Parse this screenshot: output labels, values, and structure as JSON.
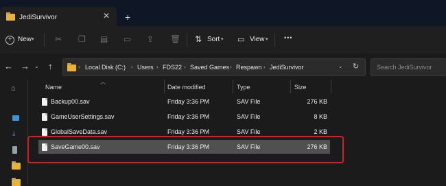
{
  "window": {
    "tab_title": "JediSurvivor"
  },
  "toolbar": {
    "new_label": "New",
    "sort_label": "Sort",
    "view_label": "View",
    "more_label": "•••"
  },
  "address": {
    "crumbs": [
      "Local Disk (C:)",
      "Users",
      "FDS22",
      "Saved Games",
      "Respawn",
      "JediSurvivor"
    ],
    "search_placeholder": "Search JediSurvivor"
  },
  "columns": {
    "name": "Name",
    "date": "Date modified",
    "type": "Type",
    "size": "Size"
  },
  "files": [
    {
      "name": "Backup00.sav",
      "date": "Friday 3:36 PM",
      "type": "SAV File",
      "size": "276 KB"
    },
    {
      "name": "GameUserSettings.sav",
      "date": "Friday 3:36 PM",
      "type": "SAV File",
      "size": "8 KB"
    },
    {
      "name": "GlobalSaveData.sav",
      "date": "Friday 3:36 PM",
      "type": "SAV File",
      "size": "2 KB"
    },
    {
      "name": "SaveGame00.sav",
      "date": "Friday 3:36 PM",
      "type": "SAV File",
      "size": "276 KB"
    }
  ],
  "colors": {
    "highlight": "#d61f1f",
    "folder": "#e8b23b",
    "selected_row": "#505050"
  },
  "icons": [
    "folder-icon",
    "close-icon",
    "plus-icon",
    "cut-icon",
    "copy-icon",
    "paste-icon",
    "rename-icon",
    "share-icon",
    "delete-icon",
    "sort-icon",
    "view-icon",
    "back-icon",
    "forward-icon",
    "up-icon",
    "refresh-icon",
    "chevron-down-icon",
    "home-icon",
    "gallery-icon",
    "downloads-icon",
    "drive-icon",
    "file-icon"
  ]
}
